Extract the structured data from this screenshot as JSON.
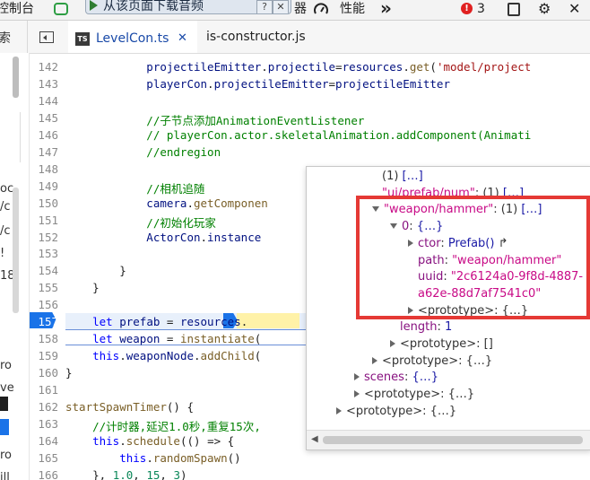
{
  "toolbar": {
    "console_tab": "控制台",
    "sources_fragment": "器",
    "performance_tab": "性能",
    "more_icon": "»",
    "error_count": "3",
    "banner_text": "从该页面下载音频",
    "banner_help": "?",
    "banner_close": "✕",
    "gear": "⚙",
    "close": "✕"
  },
  "tabs": {
    "left_partial": "索",
    "active": {
      "label": "LevelCon.ts",
      "icon": "TS",
      "close": "✕"
    },
    "second": {
      "label": "is-constructor.js"
    }
  },
  "sidebar": {
    "labels": [
      "oc",
      "/c",
      "/c",
      "!",
      "18",
      "",
      "ro",
      "ve",
      "",
      "ro",
      "ill"
    ]
  },
  "editor": {
    "lines": [
      {
        "n": "142",
        "segs": [
          [
            "id",
            "            projectileEmitter"
          ],
          [
            "",
            "."
          ],
          [
            "id",
            "projectile"
          ],
          [
            "",
            "="
          ],
          [
            "id",
            "resources"
          ],
          [
            "",
            "."
          ],
          [
            "fn",
            "get"
          ],
          [
            "",
            "("
          ],
          [
            "str",
            "'model/project"
          ]
        ]
      },
      {
        "n": "143",
        "segs": [
          [
            "id",
            "            playerCon"
          ],
          [
            "",
            "."
          ],
          [
            "id",
            "projectileEmitter"
          ],
          [
            "",
            "="
          ],
          [
            "id",
            "projectileEmitter"
          ]
        ]
      },
      {
        "n": "144",
        "segs": []
      },
      {
        "n": "145",
        "segs": [
          [
            "cm",
            "            //子节点添加AnimationEventListener"
          ]
        ]
      },
      {
        "n": "146",
        "segs": [
          [
            "cm",
            "            // playerCon.actor.skeletalAnimation.addComponent(Animati"
          ]
        ]
      },
      {
        "n": "147",
        "segs": [
          [
            "cm",
            "            //endregion"
          ]
        ]
      },
      {
        "n": "148",
        "segs": []
      },
      {
        "n": "149",
        "segs": [
          [
            "cm",
            "            //相机追随"
          ]
        ]
      },
      {
        "n": "150",
        "segs": [
          [
            "id",
            "            camera"
          ],
          [
            "",
            "."
          ],
          [
            "fn",
            "getComponen"
          ]
        ]
      },
      {
        "n": "151",
        "segs": [
          [
            "cm",
            "            //初始化玩家"
          ]
        ]
      },
      {
        "n": "152",
        "segs": [
          [
            "id",
            "            ActorCon"
          ],
          [
            "",
            "."
          ],
          [
            "id",
            "instance"
          ]
        ]
      },
      {
        "n": "153",
        "segs": []
      },
      {
        "n": "154",
        "segs": [
          [
            "",
            "        }"
          ]
        ]
      },
      {
        "n": "155",
        "segs": [
          [
            "",
            "    }"
          ]
        ]
      },
      {
        "n": "156",
        "segs": []
      },
      {
        "n": "157",
        "segs": [
          [
            "kw",
            "    let "
          ],
          [
            "id",
            "prefab"
          ],
          [
            "",
            " = "
          ],
          [
            "id",
            "resources"
          ],
          [
            "",
            "."
          ]
        ]
      },
      {
        "n": "158",
        "segs": [
          [
            "kw",
            "    let "
          ],
          [
            "id",
            "weapon"
          ],
          [
            "",
            " = "
          ],
          [
            "fn",
            "instantiate"
          ],
          [
            "",
            "("
          ]
        ]
      },
      {
        "n": "159",
        "segs": [
          [
            "kw",
            "    this"
          ],
          [
            "",
            "."
          ],
          [
            "id",
            "weaponNode"
          ],
          [
            "",
            "."
          ],
          [
            "fn",
            "addChild"
          ],
          [
            "",
            "("
          ]
        ]
      },
      {
        "n": "160",
        "segs": [
          [
            "",
            "}"
          ]
        ]
      },
      {
        "n": "161",
        "segs": []
      },
      {
        "n": "162",
        "segs": [
          [
            "fn",
            "startSpawnTimer"
          ],
          [
            "",
            "() {"
          ]
        ]
      },
      {
        "n": "163",
        "segs": [
          [
            "cm",
            "    //计时器,延迟1.0秒,重复15次,"
          ]
        ]
      },
      {
        "n": "164",
        "segs": [
          [
            "kw",
            "    this"
          ],
          [
            "",
            "."
          ],
          [
            "fn",
            "schedule"
          ],
          [
            "",
            "(() => {"
          ]
        ]
      },
      {
        "n": "165",
        "segs": [
          [
            "kw",
            "        this"
          ],
          [
            "",
            "."
          ],
          [
            "fn",
            "randomSpawn"
          ],
          [
            "",
            "()"
          ]
        ]
      },
      {
        "n": "166",
        "segs": [
          [
            "",
            "    }, "
          ],
          [
            "num",
            "1.0"
          ],
          [
            "",
            ", "
          ],
          [
            "num",
            "15"
          ],
          [
            "",
            ", "
          ],
          [
            "num",
            "3"
          ],
          [
            "",
            ")"
          ]
        ]
      }
    ],
    "current_line": "157"
  },
  "popup": {
    "rows": [
      {
        "indent": 0,
        "segs": [
          [
            "",
            "(1) "
          ],
          [
            "pk",
            "[…]"
          ]
        ]
      },
      {
        "indent": 0,
        "segs": [
          [
            "ps",
            "\"ui/prefab/num\""
          ],
          [
            "",
            ": (1) "
          ],
          [
            "pk",
            "[…]"
          ]
        ]
      },
      {
        "indent": 0,
        "tri": "down",
        "segs": [
          [
            "ps",
            "\"weapon/hammer\""
          ],
          [
            "",
            ": (1) "
          ],
          [
            "pk",
            "[…]"
          ]
        ]
      },
      {
        "indent": 1,
        "tri": "down",
        "segs": [
          [
            "key",
            "0"
          ],
          [
            "",
            ": "
          ],
          [
            "pk",
            "{…}"
          ]
        ]
      },
      {
        "indent": 2,
        "tri": "right",
        "segs": [
          [
            "key",
            "ctor"
          ],
          [
            "",
            ": "
          ],
          [
            "pk",
            "Prefab() "
          ],
          [
            "",
            "↱"
          ]
        ]
      },
      {
        "indent": 2,
        "segs": [
          [
            "key",
            "path"
          ],
          [
            "",
            ": "
          ],
          [
            "ps",
            "\"weapon/hammer\""
          ]
        ]
      },
      {
        "indent": 2,
        "segs": [
          [
            "key",
            "uuid"
          ],
          [
            "",
            ": "
          ],
          [
            "ps",
            "\"2c6124a0-9f8d-4887-"
          ]
        ]
      },
      {
        "indent": 2,
        "segs": [
          [
            "ps",
            "a62e-88d7af7541c0\""
          ]
        ]
      },
      {
        "indent": 2,
        "tri": "right",
        "segs": [
          [
            "",
            "<prototype>: {…}"
          ]
        ]
      },
      {
        "indent": 1,
        "segs": [
          [
            "key",
            "length"
          ],
          [
            "",
            ": "
          ],
          [
            "pn",
            "1"
          ]
        ]
      },
      {
        "indent": 1,
        "tri": "right",
        "segs": [
          [
            "",
            "<prototype>: []"
          ]
        ]
      },
      {
        "indent": 0,
        "tri": "right",
        "segs": [
          [
            "",
            "<prototype>: {…}"
          ]
        ]
      },
      {
        "indent": -1,
        "tri": "right",
        "segs": [
          [
            "key",
            "scenes"
          ],
          [
            "",
            ": "
          ],
          [
            "pk",
            "{…}"
          ]
        ]
      },
      {
        "indent": -1,
        "tri": "right",
        "segs": [
          [
            "",
            "<prototype>: {…}"
          ]
        ]
      },
      {
        "indent": -2,
        "tri": "right",
        "segs": [
          [
            "",
            "<prototype>: {…}"
          ]
        ]
      }
    ]
  },
  "colors": {
    "highlight_box": "#e53935",
    "current_line_bg": "#e8f0fb",
    "breakpoint": "#1a73e8"
  }
}
